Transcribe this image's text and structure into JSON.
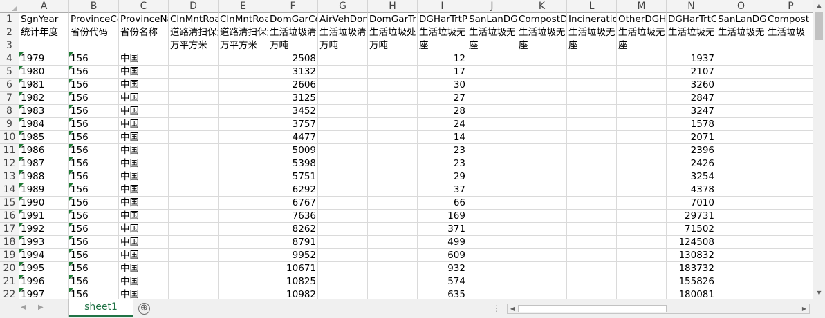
{
  "columns": [
    "A",
    "B",
    "C",
    "D",
    "E",
    "F",
    "G",
    "H",
    "I",
    "J",
    "K",
    "L",
    "M",
    "N",
    "O",
    "P"
  ],
  "rows": [
    [
      "SgnYear",
      "ProvinceCode",
      "ProvinceName",
      "ClnMntRoad",
      "ClnMntRoad",
      "DomGarCol",
      "AirVehDom",
      "DomGarTr",
      "DGHarTrtP",
      "SanLanDG",
      "CompostD",
      "Incineratio",
      "OtherDGH",
      "DGHarTrtC",
      "SanLanDG",
      "Compost"
    ],
    [
      "统计年度",
      "省份代码",
      "省份名称",
      "道路清扫保洁",
      "道路清扫保洁",
      "生活垃圾清运",
      "生活垃圾清运",
      "生活垃圾处",
      "生活垃圾无",
      "生活垃圾无",
      "生活垃圾无",
      "生活垃圾无",
      "生活垃圾无",
      "生活垃圾无",
      "生活垃圾无",
      "生活垃圾"
    ],
    [
      "",
      "",
      "",
      "万平方米",
      "万平方米",
      "万吨",
      "万吨",
      "万吨",
      "座",
      "座",
      "座",
      "座",
      "座",
      "",
      "",
      ""
    ],
    [
      "1979",
      "156",
      "中国",
      "",
      "",
      "2508",
      "",
      "",
      "12",
      "",
      "",
      "",
      "",
      "1937",
      "",
      ""
    ],
    [
      "1980",
      "156",
      "中国",
      "",
      "",
      "3132",
      "",
      "",
      "17",
      "",
      "",
      "",
      "",
      "2107",
      "",
      ""
    ],
    [
      "1981",
      "156",
      "中国",
      "",
      "",
      "2606",
      "",
      "",
      "30",
      "",
      "",
      "",
      "",
      "3260",
      "",
      ""
    ],
    [
      "1982",
      "156",
      "中国",
      "",
      "",
      "3125",
      "",
      "",
      "27",
      "",
      "",
      "",
      "",
      "2847",
      "",
      ""
    ],
    [
      "1983",
      "156",
      "中国",
      "",
      "",
      "3452",
      "",
      "",
      "28",
      "",
      "",
      "",
      "",
      "3247",
      "",
      ""
    ],
    [
      "1984",
      "156",
      "中国",
      "",
      "",
      "3757",
      "",
      "",
      "24",
      "",
      "",
      "",
      "",
      "1578",
      "",
      ""
    ],
    [
      "1985",
      "156",
      "中国",
      "",
      "",
      "4477",
      "",
      "",
      "14",
      "",
      "",
      "",
      "",
      "2071",
      "",
      ""
    ],
    [
      "1986",
      "156",
      "中国",
      "",
      "",
      "5009",
      "",
      "",
      "23",
      "",
      "",
      "",
      "",
      "2396",
      "",
      ""
    ],
    [
      "1987",
      "156",
      "中国",
      "",
      "",
      "5398",
      "",
      "",
      "23",
      "",
      "",
      "",
      "",
      "2426",
      "",
      ""
    ],
    [
      "1988",
      "156",
      "中国",
      "",
      "",
      "5751",
      "",
      "",
      "29",
      "",
      "",
      "",
      "",
      "3254",
      "",
      ""
    ],
    [
      "1989",
      "156",
      "中国",
      "",
      "",
      "6292",
      "",
      "",
      "37",
      "",
      "",
      "",
      "",
      "4378",
      "",
      ""
    ],
    [
      "1990",
      "156",
      "中国",
      "",
      "",
      "6767",
      "",
      "",
      "66",
      "",
      "",
      "",
      "",
      "7010",
      "",
      ""
    ],
    [
      "1991",
      "156",
      "中国",
      "",
      "",
      "7636",
      "",
      "",
      "169",
      "",
      "",
      "",
      "",
      "29731",
      "",
      ""
    ],
    [
      "1992",
      "156",
      "中国",
      "",
      "",
      "8262",
      "",
      "",
      "371",
      "",
      "",
      "",
      "",
      "71502",
      "",
      ""
    ],
    [
      "1993",
      "156",
      "中国",
      "",
      "",
      "8791",
      "",
      "",
      "499",
      "",
      "",
      "",
      "",
      "124508",
      "",
      ""
    ],
    [
      "1994",
      "156",
      "中国",
      "",
      "",
      "9952",
      "",
      "",
      "609",
      "",
      "",
      "",
      "",
      "130832",
      "",
      ""
    ],
    [
      "1995",
      "156",
      "中国",
      "",
      "",
      "10671",
      "",
      "",
      "932",
      "",
      "",
      "",
      "",
      "183732",
      "",
      ""
    ],
    [
      "1996",
      "156",
      "中国",
      "",
      "",
      "10825",
      "",
      "",
      "574",
      "",
      "",
      "",
      "",
      "155826",
      "",
      ""
    ],
    [
      "1997",
      "156",
      "中国",
      "",
      "",
      "10982",
      "",
      "",
      "635",
      "",
      "",
      "",
      "",
      "180081",
      "",
      ""
    ]
  ],
  "sheet_tabs": [
    "sheet1"
  ],
  "add_sheet_glyph": "⊕",
  "colors": {
    "accent": "#217346",
    "text_number_marker": "#1e7b34"
  }
}
